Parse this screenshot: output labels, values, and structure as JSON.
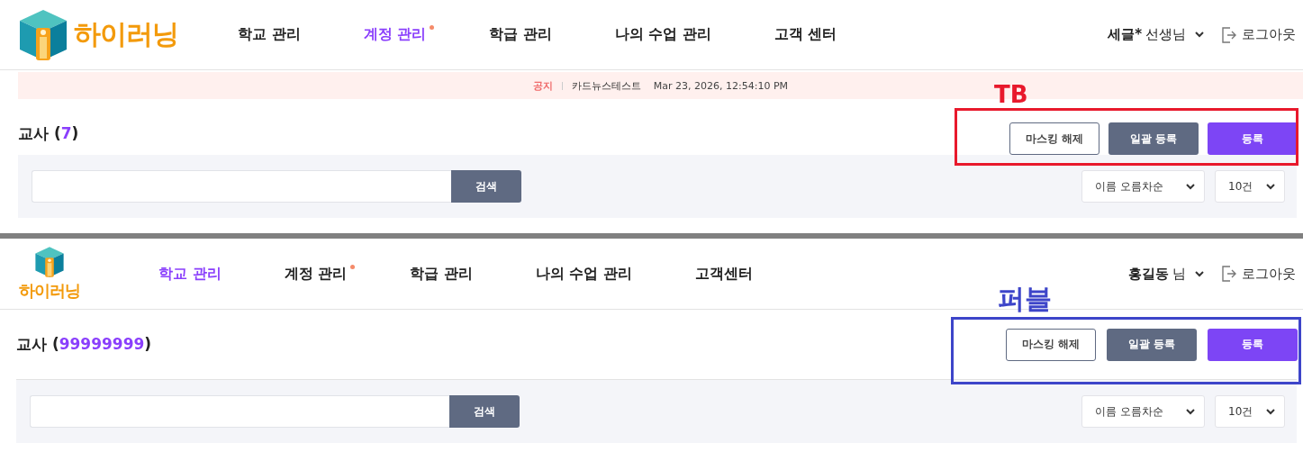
{
  "panels": [
    {
      "logo": {
        "kind": "horizontal",
        "text": "하이러닝"
      },
      "nav": [
        {
          "label": "학교 관리",
          "selected": false,
          "has_dot": false
        },
        {
          "label": "계정 관리",
          "selected": true,
          "has_dot": true
        },
        {
          "label": "학급 관리",
          "selected": false,
          "has_dot": false
        },
        {
          "label": "나의 수업 관리",
          "selected": false,
          "has_dot": false
        },
        {
          "label": "고객 센터",
          "selected": false,
          "has_dot": false
        }
      ],
      "user": {
        "name": "세글*",
        "title": "선생님"
      },
      "logout": "로그아웃",
      "notice": {
        "label": "공지",
        "title": "카드뉴스테스트",
        "date": "Mar 23, 2026, 12:54:10 PM"
      },
      "heading": "교사 (**7**)",
      "buttons": [
        {
          "label": "마스킹 해제",
          "kind": "outline"
        },
        {
          "label": "일괄 등록",
          "kind": "secondary"
        },
        {
          "label": "등록",
          "kind": "primary"
        }
      ],
      "search_button": "검색",
      "sort": "이름 오름차순",
      "page_size": "10건",
      "annotation": {
        "label": "TB",
        "color": "#e8192c"
      }
    },
    {
      "logo": {
        "kind": "stacked",
        "text": "하이러닝"
      },
      "nav": [
        {
          "label": "학교 관리",
          "selected": true,
          "has_dot": false
        },
        {
          "label": "계정 관리",
          "selected": false,
          "has_dot": true
        },
        {
          "label": "학급 관리",
          "selected": false,
          "has_dot": false
        },
        {
          "label": "나의 수업 관리",
          "selected": false,
          "has_dot": false
        },
        {
          "label": "고객센터",
          "selected": false,
          "has_dot": false
        }
      ],
      "user": {
        "name": "홍길동",
        "title": "님"
      },
      "logout": "로그아웃",
      "heading": "교사 (**99999999**)",
      "buttons": [
        {
          "label": "마스킹 해제",
          "kind": "outline"
        },
        {
          "label": "일괄 등록",
          "kind": "secondary"
        },
        {
          "label": "등록",
          "kind": "primary"
        }
      ],
      "search_button": "검색",
      "sort": "이름 오름차순",
      "page_size": "10건",
      "annotation": {
        "label": "퍼블",
        "color": "#3d45c9"
      }
    }
  ]
}
